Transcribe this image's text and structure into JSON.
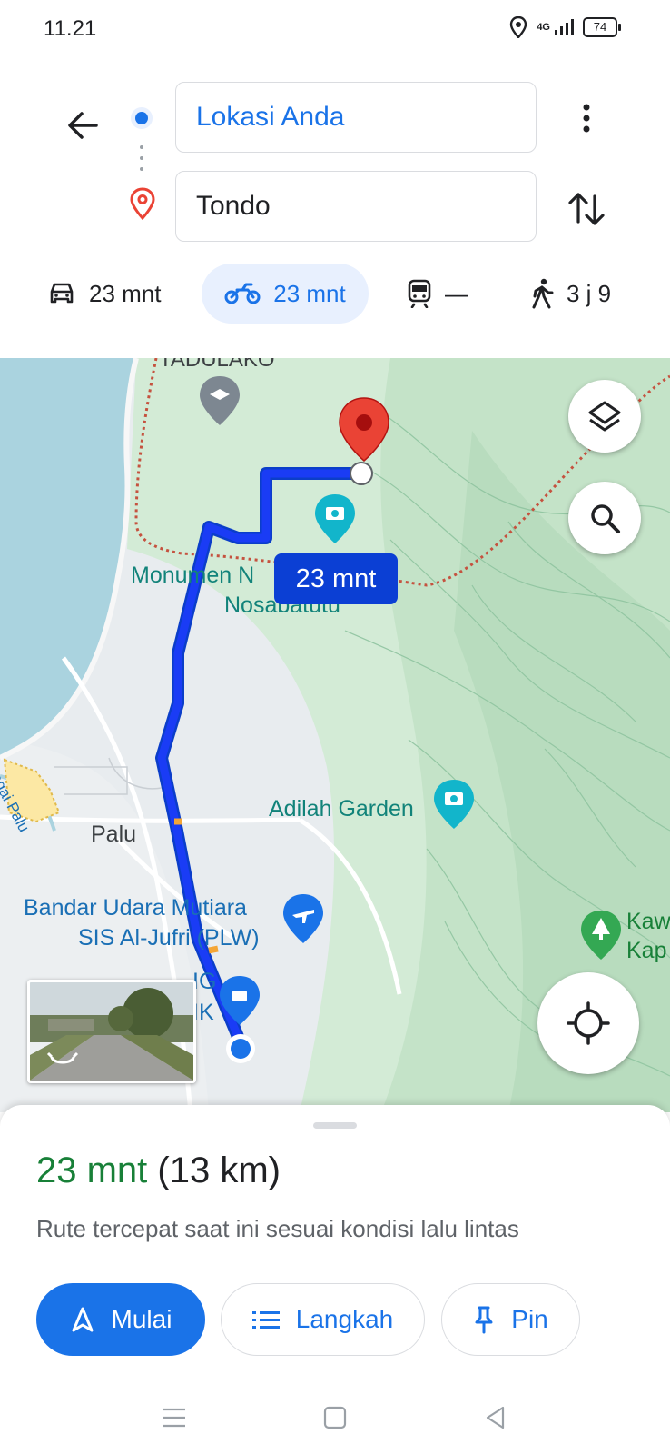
{
  "status_bar": {
    "time": "11.21",
    "network": "4G",
    "battery": "74"
  },
  "directions": {
    "origin": "Lokasi Anda",
    "destination": "Tondo"
  },
  "modes": [
    {
      "name": "car",
      "icon": "car-icon",
      "time": "23 mnt"
    },
    {
      "name": "motorcycle",
      "icon": "motorcycle-icon",
      "time": "23 mnt",
      "selected": true
    },
    {
      "name": "transit",
      "icon": "train-icon",
      "time": "—"
    },
    {
      "name": "walk",
      "icon": "walk-icon",
      "time": "3 j 9"
    }
  ],
  "map": {
    "labels": {
      "top_cut": "TADULAKO",
      "monumen_1": "Monumen N",
      "monumen_2": "Nosabatutu",
      "adilah": "Adilah Garden",
      "sungai": "Sungai Palu",
      "palu": "Palu",
      "bandara_1": "Bandar Udara Mutiara",
      "bandara_2": "SIS Al-Jufri (PLW)",
      "kaw_1": "Kaw",
      "kaw_2": "Kap",
      "ig": "IG",
      "ik": "IK"
    },
    "route_badge": "23 mnt",
    "colors": {
      "route": "#1a3cf5",
      "water": "#aad3df",
      "park": "#c8e6c9",
      "badge": "#0b3fd4"
    }
  },
  "sheet": {
    "duration": "23 mnt",
    "distance": "(13 km)",
    "description": "Rute tercepat saat ini sesuai kondisi lalu lintas",
    "buttons": {
      "start": "Mulai",
      "steps": "Langkah",
      "pin": "Pin"
    }
  },
  "colors": {
    "accent": "#1a73e8",
    "duration_green": "#188038",
    "pin_red": "#ea4335"
  }
}
